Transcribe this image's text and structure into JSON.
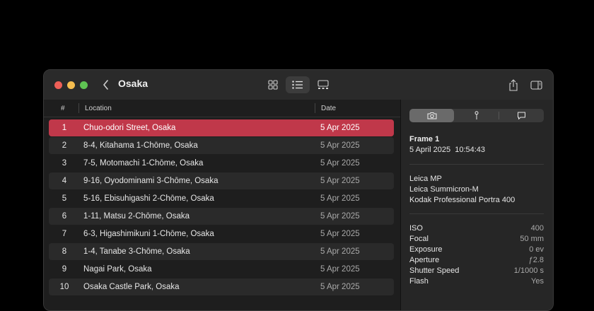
{
  "window": {
    "title": "Osaka"
  },
  "toolbar": {
    "back_icon": "chevron-left-icon",
    "view_buttons": [
      "grid-view-icon",
      "list-view-icon",
      "gallery-view-icon"
    ],
    "active_view": "list",
    "right_buttons": [
      "share-icon",
      "sidebar-toggle-icon"
    ]
  },
  "list": {
    "headers": {
      "num": "#",
      "location": "Location",
      "date": "Date"
    },
    "rows": [
      {
        "num": "1",
        "location": "Chuo-odori Street, Osaka",
        "date": "5 Apr 2025"
      },
      {
        "num": "2",
        "location": "8-4, Kitahama 1-Chōme, Osaka",
        "date": "5 Apr 2025"
      },
      {
        "num": "3",
        "location": "7-5, Motomachi 1-Chōme, Osaka",
        "date": "5 Apr 2025"
      },
      {
        "num": "4",
        "location": "9-16, Oyodominami 3-Chōme, Osaka",
        "date": "5 Apr 2025"
      },
      {
        "num": "5",
        "location": "5-16, Ebisuhigashi 2-Chōme, Osaka",
        "date": "5 Apr 2025"
      },
      {
        "num": "6",
        "location": "1-11, Matsu 2-Chōme, Osaka",
        "date": "5 Apr 2025"
      },
      {
        "num": "7",
        "location": "6-3, Higashimikuni 1-Chōme, Osaka",
        "date": "5 Apr 2025"
      },
      {
        "num": "8",
        "location": "1-4, Tanabe 3-Chōme, Osaka",
        "date": "5 Apr 2025"
      },
      {
        "num": "9",
        "location": "Nagai Park, Osaka",
        "date": "5 Apr 2025"
      },
      {
        "num": "10",
        "location": "Osaka Castle Park, Osaka",
        "date": "5 Apr 2025"
      }
    ],
    "selected_index": 0
  },
  "inspector": {
    "tabs": [
      "camera-icon",
      "pin-icon",
      "comment-icon"
    ],
    "active_tab": 0,
    "frame_title": "Frame 1",
    "frame_date": "5 April 2025  10:54:43",
    "gear": [
      "Leica MP",
      "Leica Summicron-M",
      "Kodak Professional Portra 400"
    ],
    "properties": [
      {
        "label": "ISO",
        "value": "400"
      },
      {
        "label": "Focal",
        "value": "50 mm"
      },
      {
        "label": "Exposure",
        "value": "0 ev"
      },
      {
        "label": "Aperture",
        "value": "ƒ2.8"
      },
      {
        "label": "Shutter Speed",
        "value": "1/1000 s"
      },
      {
        "label": "Flash",
        "value": "Yes"
      }
    ]
  },
  "colors": {
    "selection": "#c0384a",
    "close": "#ee5f57",
    "minimize": "#f5bd4f",
    "zoom": "#5fc453"
  }
}
